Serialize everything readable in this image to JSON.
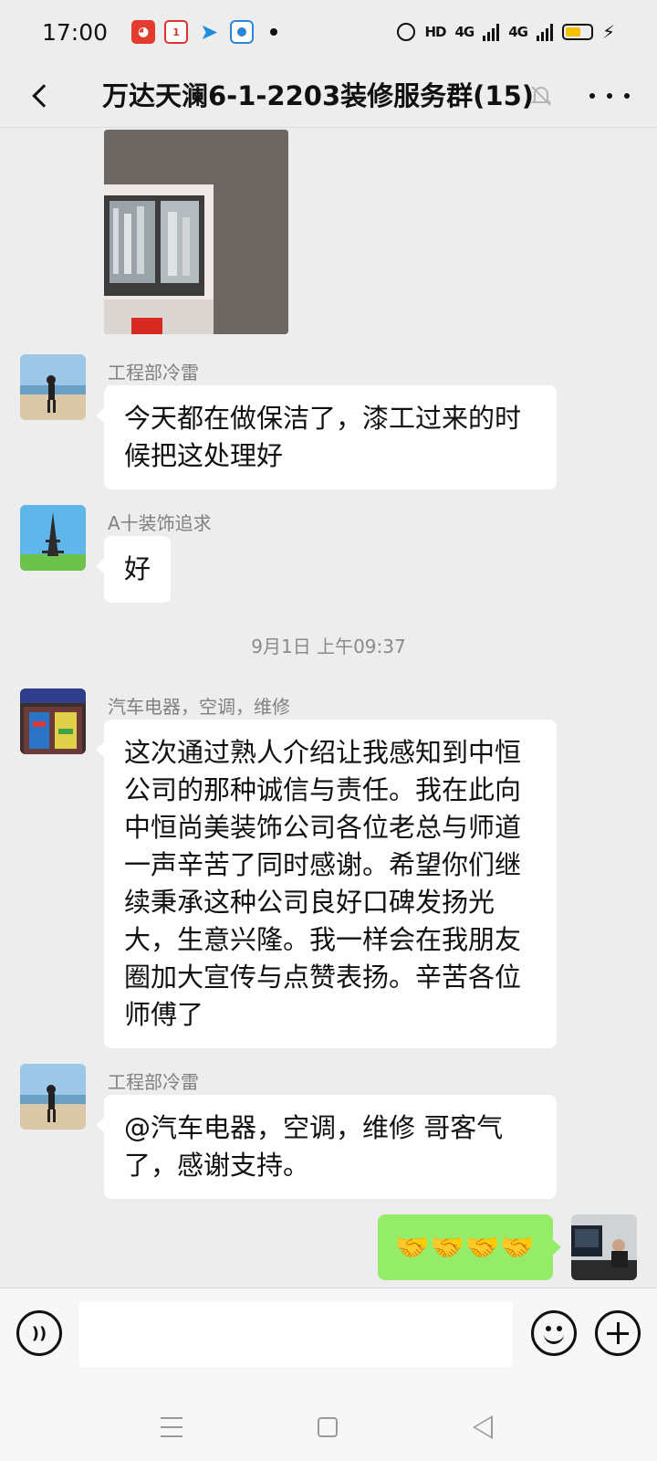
{
  "status_bar": {
    "time": "17:00",
    "hd_label": "HD",
    "network_1": "4G",
    "network_2": "4G",
    "notification_icons": [
      "app-red-icon",
      "calendar-icon",
      "telegram-icon",
      "blue-circle-app-icon"
    ],
    "battery_color": "#f2c200"
  },
  "header": {
    "title": "万达天澜6-1-2203装修服务群(15)",
    "icons": [
      "back-chevron-icon",
      "mute-bell-icon",
      "more-dots-icon"
    ]
  },
  "messages": [
    {
      "type": "image",
      "description_icon": "photo-window-icon"
    },
    {
      "sender": "工程部冷雷",
      "text": "今天都在做保洁了，漆工过来的时候把这处理好"
    },
    {
      "sender": "A十装饰追求",
      "text": "好"
    },
    {
      "sender": "汽车电器，空调，维修",
      "text": "这次通过熟人介绍让我感知到中恒公司的那种诚信与责任。我在此向中恒尚美装饰公司各位老总与师道一声辛苦了同时感谢。希望你们继续秉承这种公司良好口碑发扬光大，生意兴隆。我一样会在我朋友圈加大宣传与点赞表扬。辛苦各位师傅了"
    },
    {
      "sender": "工程部冷雷",
      "text": "@汽车电器，空调，维修  哥客气了，感谢支持。"
    },
    {
      "sender": "self",
      "text": "🤝🤝🤝🤝"
    }
  ],
  "time_divider": "9月1日 上午09:37",
  "input_bar": {
    "placeholder": "",
    "voice_icon": "voice-icon",
    "emoji_icon": "emoji-icon",
    "plus_icon": "plus-icon"
  },
  "colors": {
    "background": "#ededed",
    "bubble_other": "#ffffff",
    "bubble_self": "#95ec69"
  }
}
